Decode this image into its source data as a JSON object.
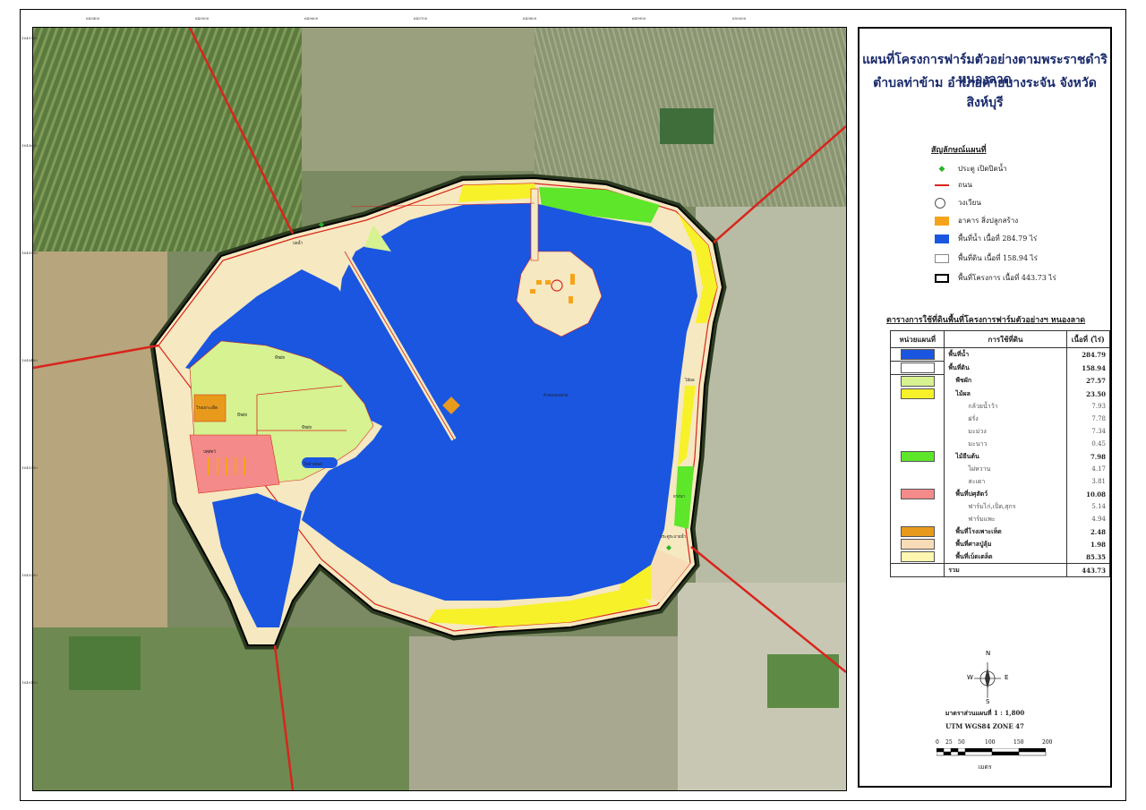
{
  "map": {
    "title_line1": "แผนที่โครงการฟาร์มตัวอย่างตามพระราชดำริหนองลาด",
    "title_line2": "ตำบลท่าข้าม อำเภอค่ายบางระจัน จังหวัดสิงห์บุรี",
    "colors": {
      "water": "#1a56e0",
      "land": "#f6e8c0",
      "vegetable": "#d6f291",
      "fruit": "#f7f12a",
      "perennial": "#5ee62a",
      "livestock": "#f48a8a",
      "mushroom": "#e89a1c",
      "pavilion": "#f8dcb8",
      "misc": "#fff7b0",
      "road": "#d8251c",
      "building": "#f5a41a"
    },
    "top_ticks": [
      "649400",
      "649500",
      "649600",
      "649700",
      "649800",
      "649900",
      "650000"
    ],
    "left_ticks": [
      "1649700",
      "1649600",
      "1649500",
      "1649400",
      "1649300",
      "1649200",
      "1649100"
    ],
    "labels": {
      "lake": "ห้วยหนองลาด",
      "canal": "บ่อน้ำ",
      "vegetable_a": "พืชผัก",
      "vegetable_b": "พืชผัก",
      "vegetable_c": "พืชผัก",
      "mushroom_house": "โรงเพาะเห็ด",
      "livestock": "ปศุสัตว์",
      "solar": "โซล่าเซลล์",
      "fruit_e": "ไม้ผล",
      "perennial_e": "ยางนา",
      "gate": "ประตูระบายน้ำ"
    }
  },
  "legend": {
    "heading": "สัญลักษณ์แผนที่",
    "items": [
      {
        "label": "ประตู เปิดปิดน้ำ",
        "icon": "green-diamond-icon"
      },
      {
        "label": "ถนน",
        "icon": "road-line-icon"
      },
      {
        "label": "วงเวียน",
        "icon": "circle-icon"
      },
      {
        "label": "อาคาร สิ่งปลูกสร้าง",
        "icon": "building-icon"
      },
      {
        "label": "พื้นที่น้ำ เนื้อที่ 284.79 ไร่",
        "icon": "water-swatch-icon"
      },
      {
        "label": "พื้นที่ดิน เนื้อที่ 158.94 ไร่",
        "icon": "land-swatch-icon"
      },
      {
        "label": "พื้นที่โครงการ เนื้อที่ 443.73 ไร่",
        "icon": "boundary-swatch-icon"
      }
    ]
  },
  "table": {
    "title": "ตารางการใช้ที่ดินพื้นที่โครงการฟาร์มตัวอย่างฯ หนองลาด",
    "headers": [
      "หน่วยแผนที่",
      "การใช้ที่ดิน",
      "เนื้อที่ (ไร่)"
    ],
    "rows": [
      {
        "swatch": "#1a56e0",
        "name": "พื้นที่น้ำ",
        "value": "284.79",
        "level": 0
      },
      {
        "swatch": "#ffffff",
        "name": "พื้นที่ดิน",
        "value": "158.94",
        "level": 0
      },
      {
        "swatch": "#d6f291",
        "name": "พืชผัก",
        "value": "27.57",
        "level": 1
      },
      {
        "swatch": "#f7f12a",
        "name": "ไม้ผล",
        "value": "23.50",
        "level": 1
      },
      {
        "swatch": "",
        "name": "กล้วยน้ำว้า",
        "value": "7.93",
        "level": 2
      },
      {
        "swatch": "",
        "name": "ฝรั่ง",
        "value": "7.78",
        "level": 2
      },
      {
        "swatch": "",
        "name": "มะม่วง",
        "value": "7.34",
        "level": 2
      },
      {
        "swatch": "",
        "name": "มะนาว",
        "value": "0.45",
        "level": 2
      },
      {
        "swatch": "#5ee62a",
        "name": "ไม้ยืนต้น",
        "value": "7.98",
        "level": 1
      },
      {
        "swatch": "",
        "name": "ไผ่หวาน",
        "value": "4.17",
        "level": 2
      },
      {
        "swatch": "",
        "name": "สะเดา",
        "value": "3.81",
        "level": 2
      },
      {
        "swatch": "#f48a8a",
        "name": "พื้นที่ปศุสัตว์",
        "value": "10.08",
        "level": 1
      },
      {
        "swatch": "",
        "name": "ฟาร์มไก่,เป็ด,สุกร",
        "value": "5.14",
        "level": 2
      },
      {
        "swatch": "",
        "name": "ฟาร์มแพะ",
        "value": "4.94",
        "level": 2
      },
      {
        "swatch": "#e89a1c",
        "name": "พื้นที่โรงเพาะเห็ด",
        "value": "2.48",
        "level": 1
      },
      {
        "swatch": "#f8dcb8",
        "name": "พื้นที่ศาลปู่ลุ้ม",
        "value": "1.98",
        "level": 1
      },
      {
        "swatch": "#fff7b0",
        "name": "พื้นที่เบ็ดเตล็ด",
        "value": "85.35",
        "level": 1
      }
    ],
    "total_label": "รวม",
    "total_value": "443.73"
  },
  "compass": {
    "n": "N",
    "s": "S",
    "e": "E",
    "w": "W"
  },
  "scale": {
    "ratio": "มาตราส่วนแผนที่ 1 : 1,800",
    "projection": "UTM  WGS84  ZONE 47",
    "ticks": [
      "0",
      "25",
      "50",
      "100",
      "150",
      "200"
    ],
    "unit": "เมตร"
  }
}
